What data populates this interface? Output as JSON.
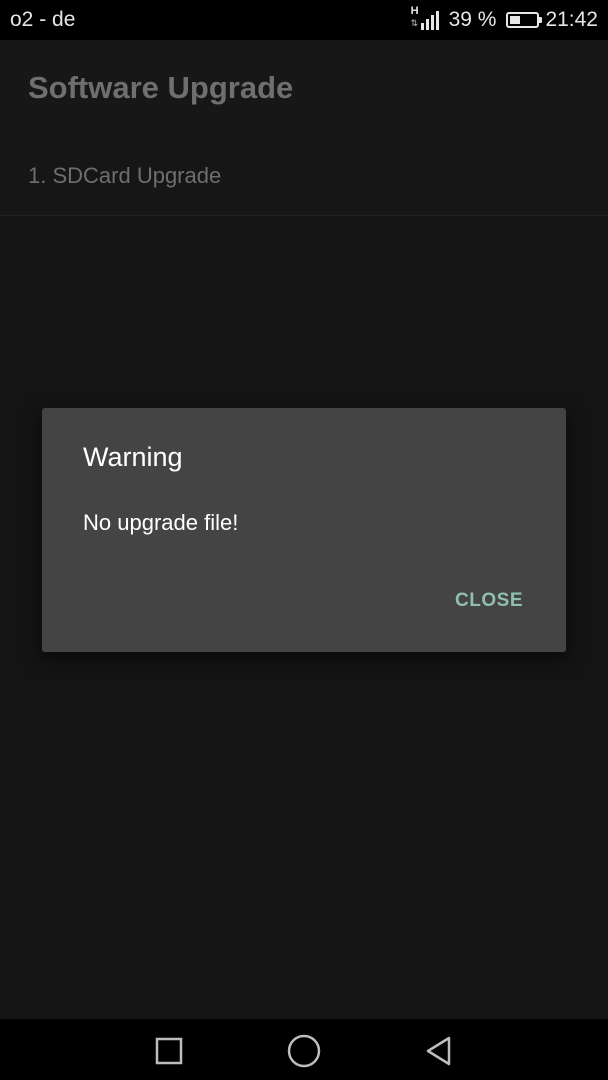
{
  "status_bar": {
    "carrier": "o2 - de",
    "network_type": "H",
    "battery_percent_label": "39 %",
    "battery_level": 0.39,
    "time": "21:42"
  },
  "app_bar": {
    "title": "Software Upgrade"
  },
  "list": {
    "items": [
      {
        "label": "1. SDCard Upgrade"
      }
    ]
  },
  "dialog": {
    "title": "Warning",
    "message": "No upgrade file!",
    "close_label": "CLOSE"
  },
  "nav_bar": {
    "icons": [
      "recent-apps-icon",
      "home-icon",
      "back-icon"
    ]
  },
  "colors": {
    "dialog_background": "#444444",
    "dialog_button_accent": "#8fbfb3",
    "app_background": "#141414"
  }
}
